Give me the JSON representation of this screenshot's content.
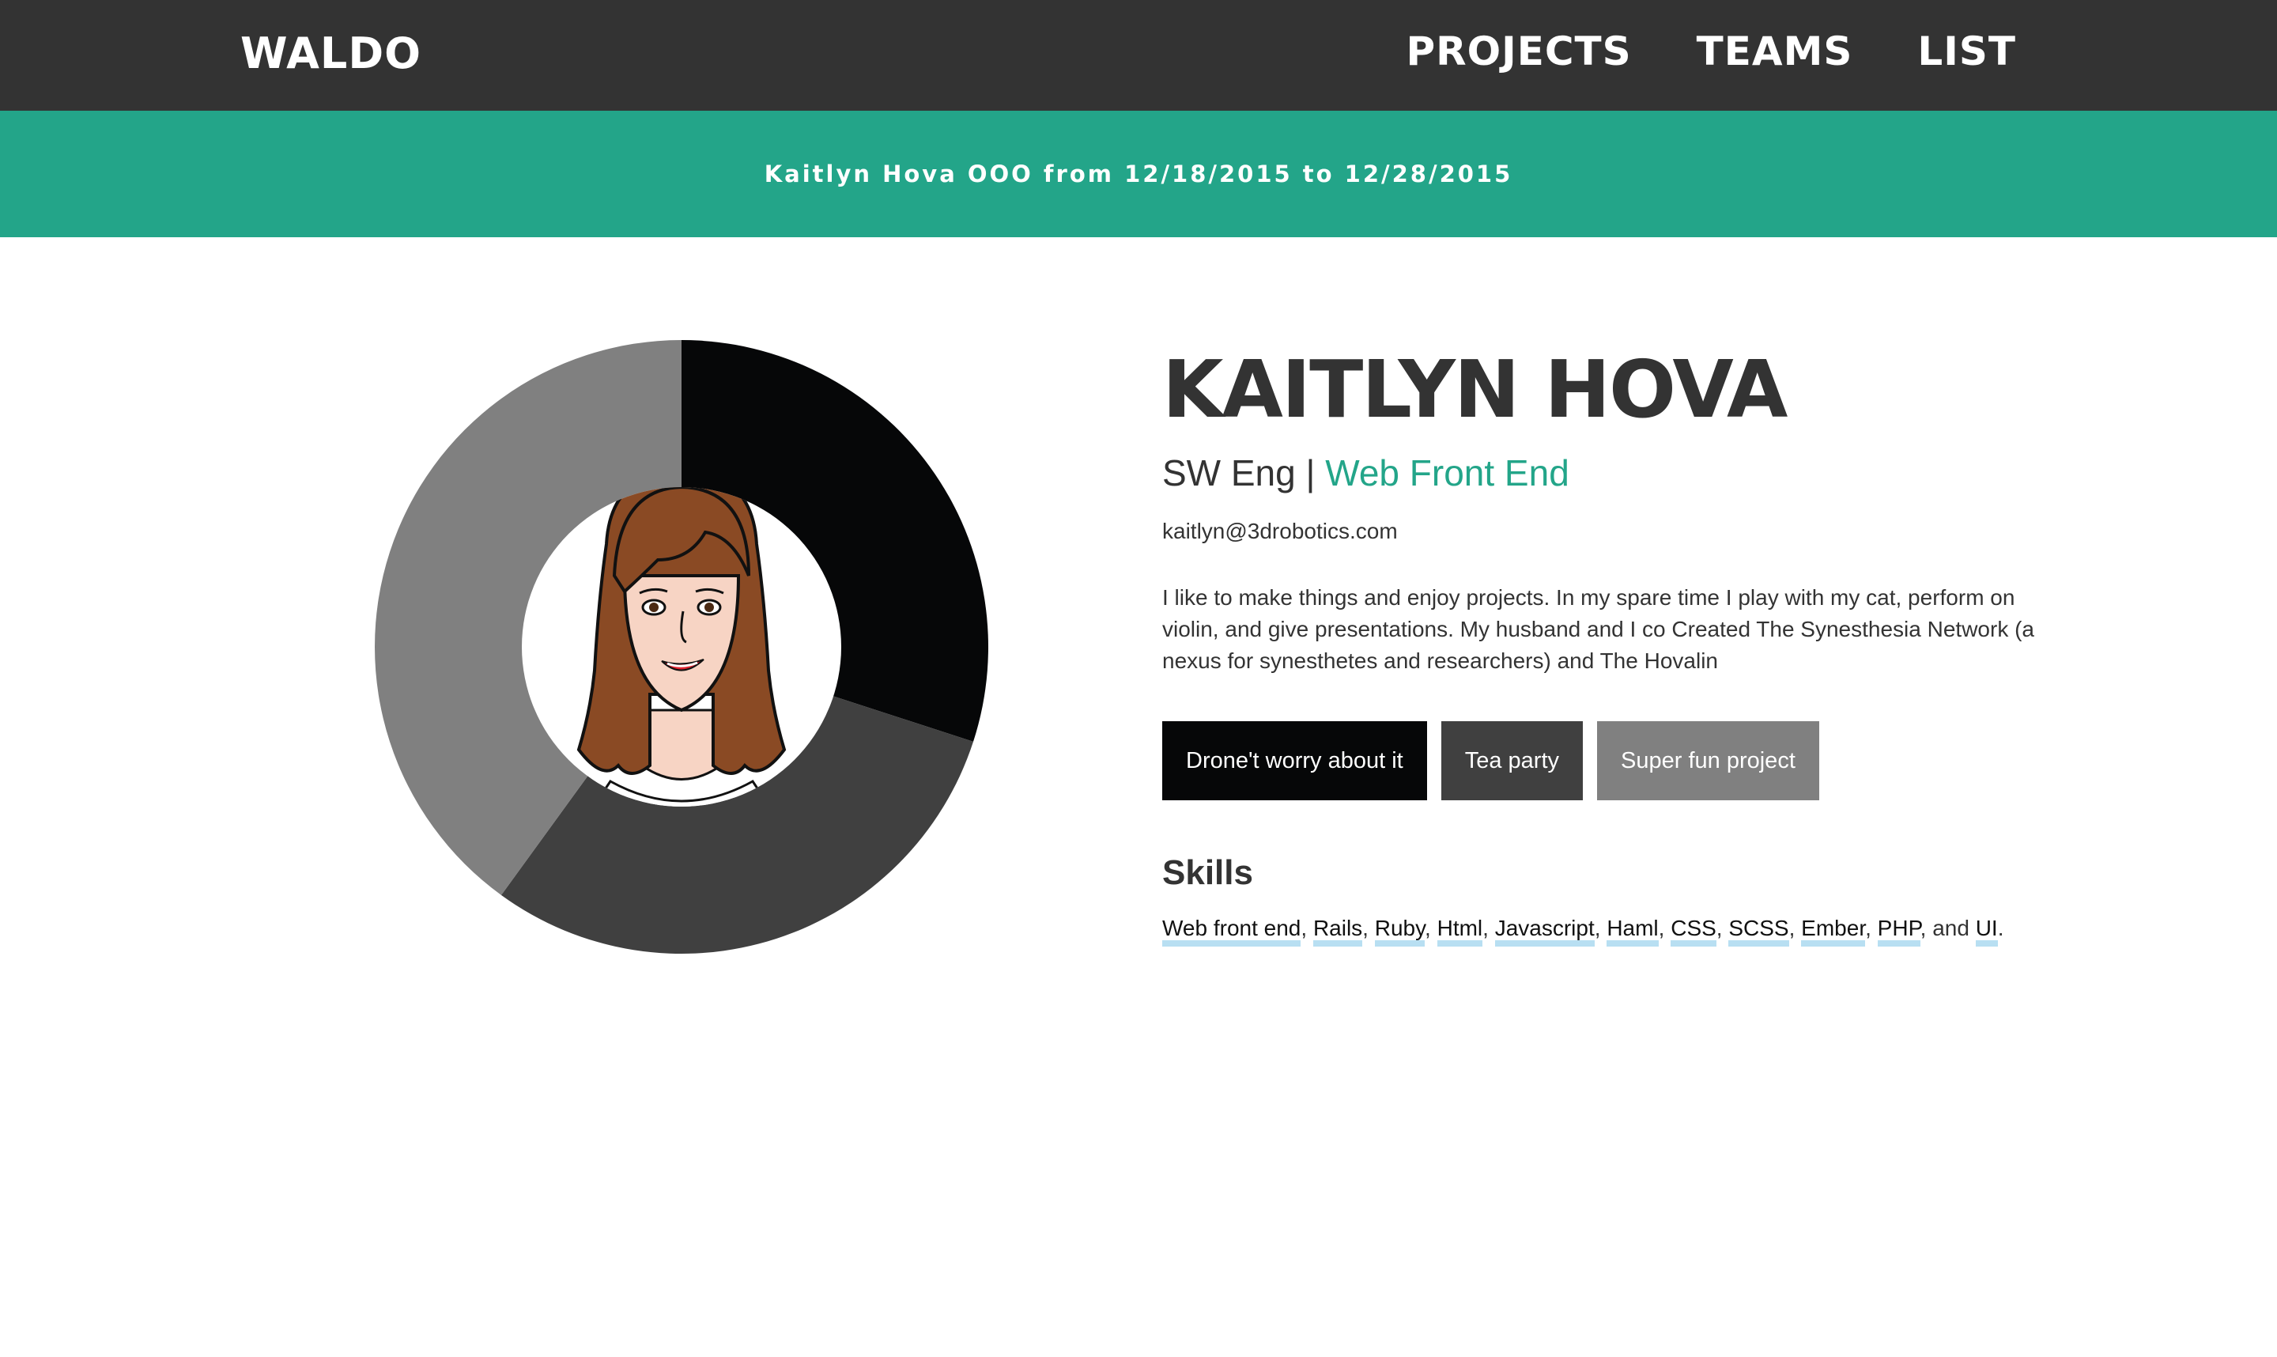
{
  "nav": {
    "brand": "WALDO",
    "links": [
      "PROJECTS",
      "TEAMS",
      "LIST"
    ]
  },
  "banner": {
    "text": "Kaitlyn Hova OOO from 12/18/2015 to 12/28/2015",
    "color": "#23a589"
  },
  "profile": {
    "name": "KAITLYN HOVA",
    "title": "SW Eng",
    "separator": " | ",
    "team": "Web Front End",
    "email": "kaitlyn@3drobotics.com",
    "bio": "I like to make things and enjoy projects. In my spare time I play with my cat, perform on violin, and give presentations. My husband and I co Created The Synesthesia Network (a nexus for synesthetes and researchers) and The Hovalin"
  },
  "projects": [
    {
      "label": "Drone't worry about it",
      "color": "#060708"
    },
    {
      "label": "Tea party",
      "color": "#404040"
    },
    {
      "label": "Super fun project",
      "color": "#808080"
    }
  ],
  "skills": {
    "heading": "Skills",
    "items": [
      "Web front end",
      "Rails",
      "Ruby",
      "Html",
      "Javascript",
      "Haml",
      "CSS",
      "SCSS",
      "Ember",
      "PHP",
      "UI"
    ],
    "and_word": "and"
  },
  "allocation": {
    "segments": [
      {
        "project": "Drone't worry about it",
        "fraction": 0.3,
        "color": "#060708"
      },
      {
        "project": "Tea party",
        "fraction": 0.3,
        "color": "#404040"
      },
      {
        "project": "Super fun project",
        "fraction": 0.4,
        "color": "#808080"
      }
    ]
  },
  "avatar": {
    "icon": "cartoon-avatar-portrait"
  }
}
